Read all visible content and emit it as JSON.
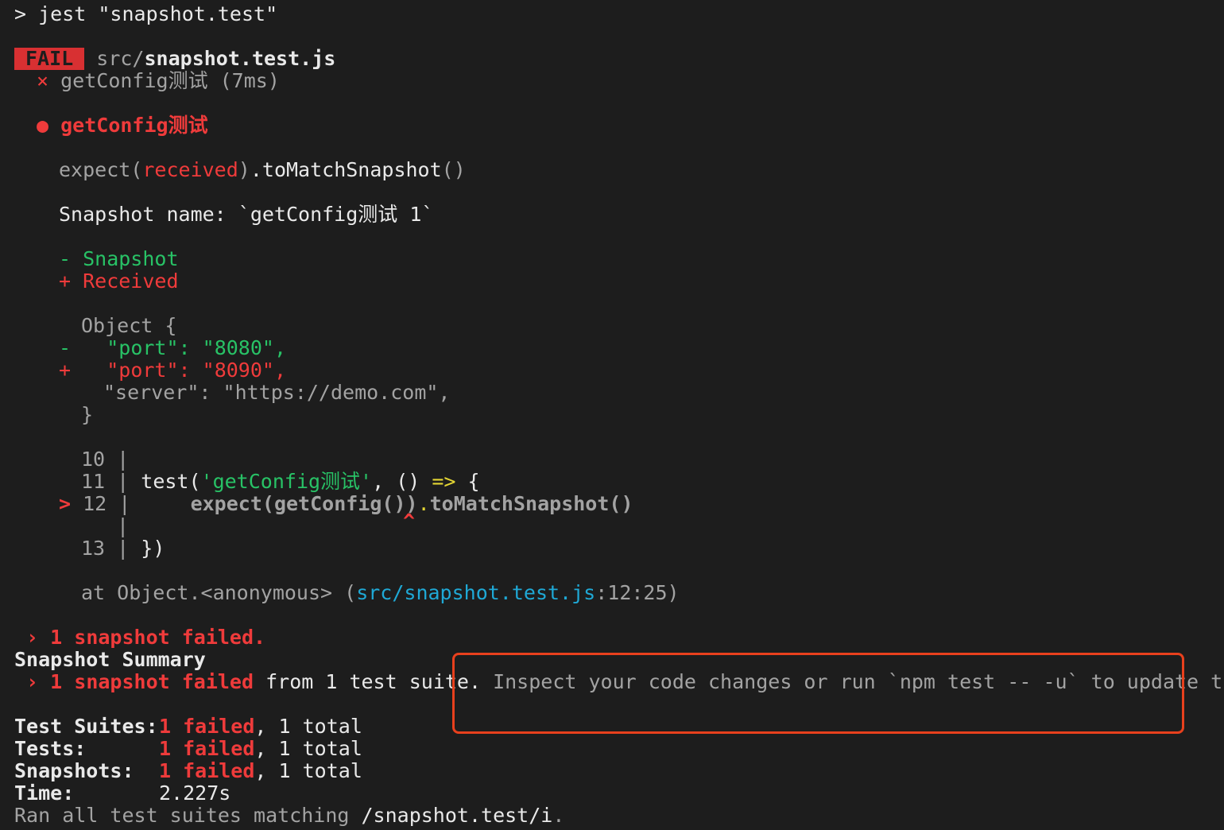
{
  "command": {
    "prompt": ">",
    "text": " jest \"snapshot.test\""
  },
  "fail_line": {
    "badge": "FAIL",
    "path_prefix": " src/",
    "file": "snapshot.test.js"
  },
  "test_result": {
    "mark": "×",
    "name": " getConfig测试 (7ms)"
  },
  "failure_header": {
    "bullet": "●",
    "title": " getConfig测试"
  },
  "expect_line": {
    "a": "expect(",
    "b": "received",
    "c": ")",
    "d": ".toMatchSnapshot",
    "e": "()"
  },
  "snapshot_name": "Snapshot name: `getConfig测试 1`",
  "legend": {
    "snapshot": "- Snapshot",
    "received": "+ Received"
  },
  "diff": {
    "open": "Object {",
    "minus_mark": "-",
    "minus_key": "\"port\"",
    "minus_sep": ": ",
    "minus_val": "\"8080\"",
    "minus_end": ",",
    "plus_mark": "+",
    "plus_key": "\"port\"",
    "plus_sep": ": ",
    "plus_val": "\"8090\"",
    "plus_end": ",",
    "server_line": "\"server\": \"https://demo.com\",",
    "close": "}"
  },
  "code_frame": {
    "l10": "10 |",
    "l11_num": "11 | ",
    "l11_a": "test(",
    "l11_b": "'getConfig测试'",
    "l11_c": ", () ",
    "l11_d": "=>",
    "l11_e": " {",
    "l12_marker": ">",
    "l12_num": " 12 |",
    "l12_a": "     expect(getConfig())",
    "l12_b": ".",
    "l12_c": "toMatchSnapshot()",
    "caret_bar": "|",
    "caret": "^",
    "l13_num": "13 | ",
    "l13_code": "})"
  },
  "stack": {
    "prefix": "at Object.<anonymous> (",
    "path": "src/snapshot.test.js",
    "suffix": ":12:25)"
  },
  "snapshot_failed": {
    "chevron": " ›",
    "text": " 1 snapshot failed."
  },
  "summary_title": "Snapshot Summary",
  "summary_line": {
    "chevron": " ›",
    "failed": " 1 snapshot failed",
    "from": " from 1 test suite.",
    "hint": " Inspect your code changes or run `npm test -- -u` to update them."
  },
  "stats": [
    {
      "label": "Test Suites:",
      "failed": "1 failed",
      "total": ", 1 total"
    },
    {
      "label": "Tests:",
      "failed": "1 failed",
      "total": ", 1 total"
    },
    {
      "label": "Snapshots:",
      "failed": "1 failed",
      "total": ", 1 total"
    }
  ],
  "time": {
    "label": "Time:",
    "value": "2.227s"
  },
  "ran_all": {
    "a": "Ran all test suites matching ",
    "b": "/snapshot.test/i",
    "c": "."
  },
  "colors": {
    "background": "#1d1d1d",
    "fail": "#d83032",
    "pass": "#28c266",
    "path": "#1fa9d6",
    "highlight_box": "#e8401d"
  }
}
